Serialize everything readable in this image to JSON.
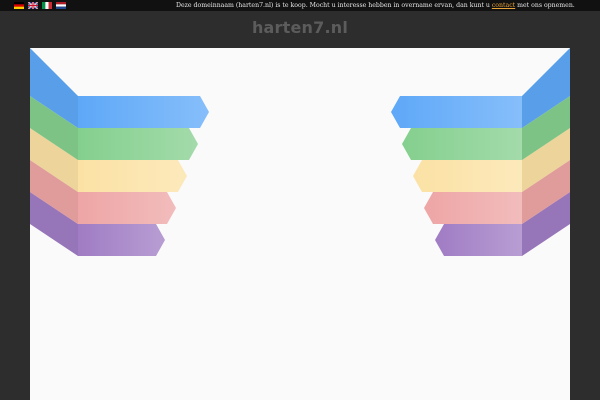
{
  "header": {
    "languages": [
      {
        "code": "de",
        "icon": "germany-flag-icon"
      },
      {
        "code": "en",
        "icon": "uk-flag-icon"
      },
      {
        "code": "it",
        "icon": "italy-flag-icon"
      },
      {
        "code": "nl",
        "icon": "netherlands-flag-icon"
      }
    ],
    "notice_before": "Deze domeinnaam (harten7.nl) is te koop. Mocht u interesse hebben in overname ervan, dan kunt u ",
    "notice_link": "contact",
    "notice_after": " met ons opnemen."
  },
  "site": {
    "title": "harten7.nl"
  },
  "graphic": {
    "ribbon_colors": [
      "#5ea8f8",
      "#84cf8e",
      "#fbe1a4",
      "#eea5a5",
      "#a07cc4"
    ]
  },
  "colors": {
    "page_background": "#2d2d2d",
    "top_bar": "#111111",
    "panel_background": "#fafafa",
    "link": "#e8a33a"
  }
}
